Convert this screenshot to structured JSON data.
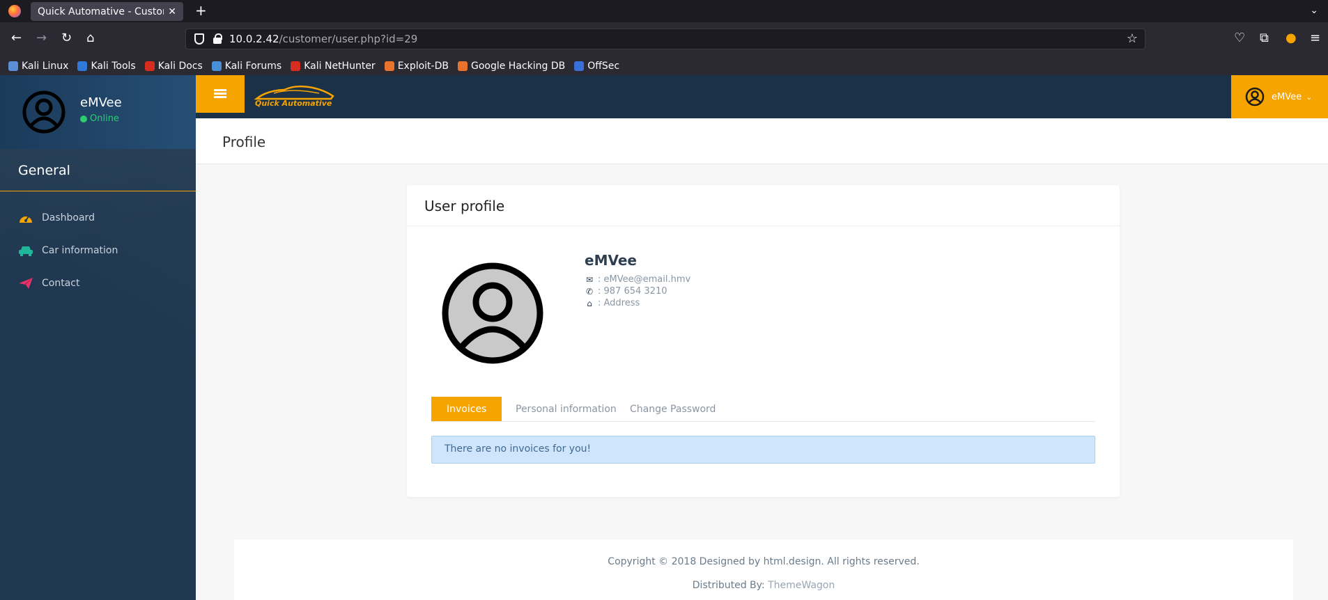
{
  "browser": {
    "tab_title": "Quick Automative - Custome",
    "url_host": "10.0.2.42",
    "url_path": "/customer/user.php?id=29",
    "bookmarks": [
      {
        "label": "Kali Linux",
        "color": "#5a8fd6"
      },
      {
        "label": "Kali Tools",
        "color": "#2f7ad6"
      },
      {
        "label": "Kali Docs",
        "color": "#d62d20"
      },
      {
        "label": "Kali Forums",
        "color": "#4a90d9"
      },
      {
        "label": "Kali NetHunter",
        "color": "#d62d20"
      },
      {
        "label": "Exploit-DB",
        "color": "#e8732c"
      },
      {
        "label": "Google Hacking DB",
        "color": "#e8732c"
      },
      {
        "label": "OffSec",
        "color": "#3b6fd8"
      }
    ]
  },
  "sidebar": {
    "user_name": "eMVee",
    "user_status": "Online",
    "heading": "General",
    "items": [
      {
        "label": "Dashboard",
        "icon": "dashboard-icon",
        "color": "#f6a400"
      },
      {
        "label": "Car information",
        "icon": "car-icon",
        "color": "#1fb79a"
      },
      {
        "label": "Contact",
        "icon": "paper-plane-icon",
        "color": "#e8336b"
      }
    ]
  },
  "topbar": {
    "brand": "Quick Automative",
    "user_name": "eMVee"
  },
  "page": {
    "title": "Profile"
  },
  "profile": {
    "card_title": "User profile",
    "name": "eMVee",
    "email": ": eMVee@email.hmv",
    "phone": ": 987 654 3210",
    "address": ": Address",
    "tabs": [
      "Invoices",
      "Personal information",
      "Change Password"
    ],
    "active_tab": "Invoices",
    "alert": "There are no invoices for you!"
  },
  "footer": {
    "copyright": "Copyright © 2018 Designed by html.design. All rights reserved.",
    "distributed_label": "Distributed By: ",
    "distributed_link": "ThemeWagon"
  },
  "colors": {
    "accent": "#f6a400",
    "sidebar": "#1f3750",
    "topbar": "#1b3148",
    "online": "#2ecc71"
  }
}
